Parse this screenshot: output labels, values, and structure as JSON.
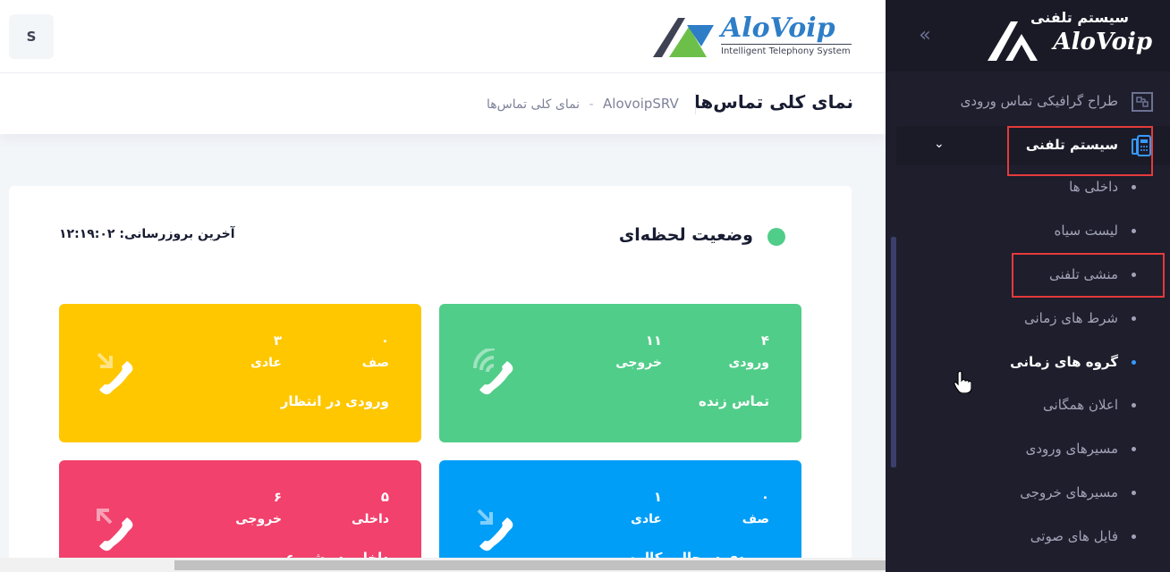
{
  "sidebar": {
    "brand_title": "سیستم تلفنی",
    "brand_name": "AloVoip",
    "toggle": "«",
    "items": [
      {
        "label": "طراح گرافیکی تماس ورودی",
        "icon": "call-designer-icon"
      },
      {
        "label": "سیستم تلفنی",
        "icon": "phone-system-icon"
      }
    ],
    "sub_items": [
      {
        "label": "داخلی ها"
      },
      {
        "label": "لیست سیاه"
      },
      {
        "label": "منشی تلفنی"
      },
      {
        "label": "شرط های زمانی"
      },
      {
        "label": "گروه های زمانی"
      },
      {
        "label": "اعلان همگانی"
      },
      {
        "label": "مسیرهای ورودی"
      },
      {
        "label": "مسیرهای خروجی"
      },
      {
        "label": "فایل های صوتی"
      }
    ]
  },
  "header": {
    "user_initial": "S",
    "brand_name": "AloVoip",
    "tagline": "Intelligent Telephony System"
  },
  "subheader": {
    "title": "نمای کلی تماس‌ها",
    "breadcrumb_root": "AlovoipSRV",
    "breadcrumb_sep": "-",
    "breadcrumb_current": "نمای کلی تماس‌ها"
  },
  "status": {
    "title": "وضعیت لحظه‌ای",
    "last_update": "آخرین بروزرسانی: ۱۲:۱۹:۰۲",
    "indicator_color": "#50cd89"
  },
  "tiles": [
    {
      "title": "تماس زنده",
      "color": "#50cd89",
      "icon": "live-call-icon",
      "a_value": "۴",
      "a_label": "ورودی",
      "b_value": "۱۱",
      "b_label": "خروجی"
    },
    {
      "title": "ورودی در انتظار",
      "color": "#ffc700",
      "icon": "incoming-call-icon",
      "a_value": "۰",
      "a_label": "صف",
      "b_value": "۳",
      "b_label": "عادی"
    },
    {
      "title": "ورودی در حال مکالمه",
      "color": "#009ef7",
      "icon": "incoming-call-icon",
      "a_value": "۰",
      "a_label": "صف",
      "b_value": "۱",
      "b_label": "عادی"
    },
    {
      "title": "داخلی در شروع",
      "color": "#f1416c",
      "icon": "outgoing-call-icon",
      "a_value": "۵",
      "a_label": "داخلی",
      "b_value": "۶",
      "b_label": "خروجی"
    }
  ]
}
